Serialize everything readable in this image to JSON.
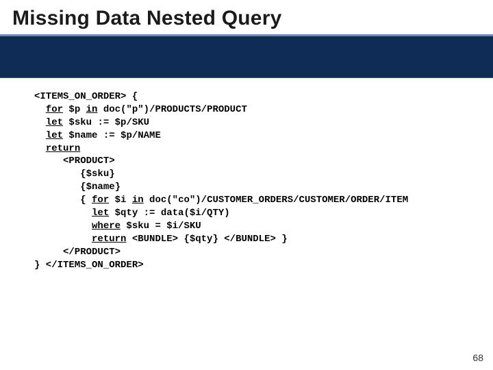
{
  "title": "Missing Data Nested Query",
  "code": {
    "l1a": "<ITEMS_ON_ORDER> {",
    "kw_for": "for",
    "l2a": " $p ",
    "kw_in": "in",
    "l2b": " doc(\"p\")/PRODUCTS/PRODUCT",
    "kw_let1": "let",
    "l3": " $sku := $p/SKU",
    "kw_let2": "let",
    "l4": " $name := $p/NAME",
    "kw_return": "return",
    "l6": "     <PRODUCT>",
    "l7": "        {$sku}",
    "l8": "        {$name}",
    "l9a": "        { ",
    "kw_for2": "for",
    "l9b": " $i ",
    "kw_in2": "in",
    "l9c": " doc(\"co\")/CUSTOMER_ORDERS/CUSTOMER/ORDER/ITEM",
    "l10a": "          ",
    "kw_let3": "let",
    "l10b": " $qty := data($i/QTY)",
    "l11a": "          ",
    "kw_where": "where",
    "l11b": " $sku = $i/SKU",
    "l12a": "          ",
    "kw_return2": "return",
    "l12b": " <BUNDLE> {$qty} </BUNDLE> }",
    "l13": "     </PRODUCT>",
    "l14": "} </ITEMS_ON_ORDER>"
  },
  "page_number": "68"
}
